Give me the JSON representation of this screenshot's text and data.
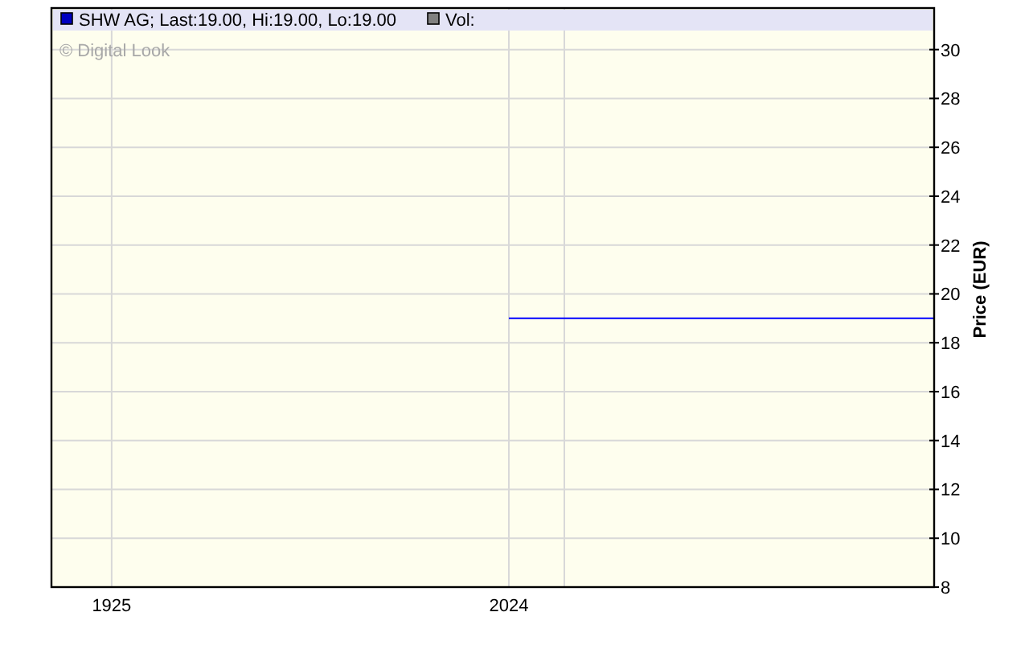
{
  "legend": [
    {
      "label": "SHW AG; Last:19.00, Hi:19.00, Lo:19.00",
      "color": "#0000c0"
    },
    {
      "label": "Vol:",
      "color": "#808080"
    }
  ],
  "credit": "© Digital Look",
  "chart_data": {
    "type": "line",
    "ylabel": "Price (EUR)",
    "xlim": [
      1910,
      2130
    ],
    "ylim": [
      8,
      31.7
    ],
    "xticks": [
      {
        "value": 1925,
        "label": "1925"
      },
      {
        "value": 2024,
        "label": "2024"
      }
    ],
    "yticks": [
      8,
      10,
      12,
      14,
      16,
      18,
      20,
      22,
      24,
      26,
      28,
      30
    ],
    "x": [
      2024,
      2130
    ],
    "grid": true,
    "series": [
      {
        "color": "#0000ff",
        "values": [
          19,
          19
        ]
      }
    ]
  }
}
